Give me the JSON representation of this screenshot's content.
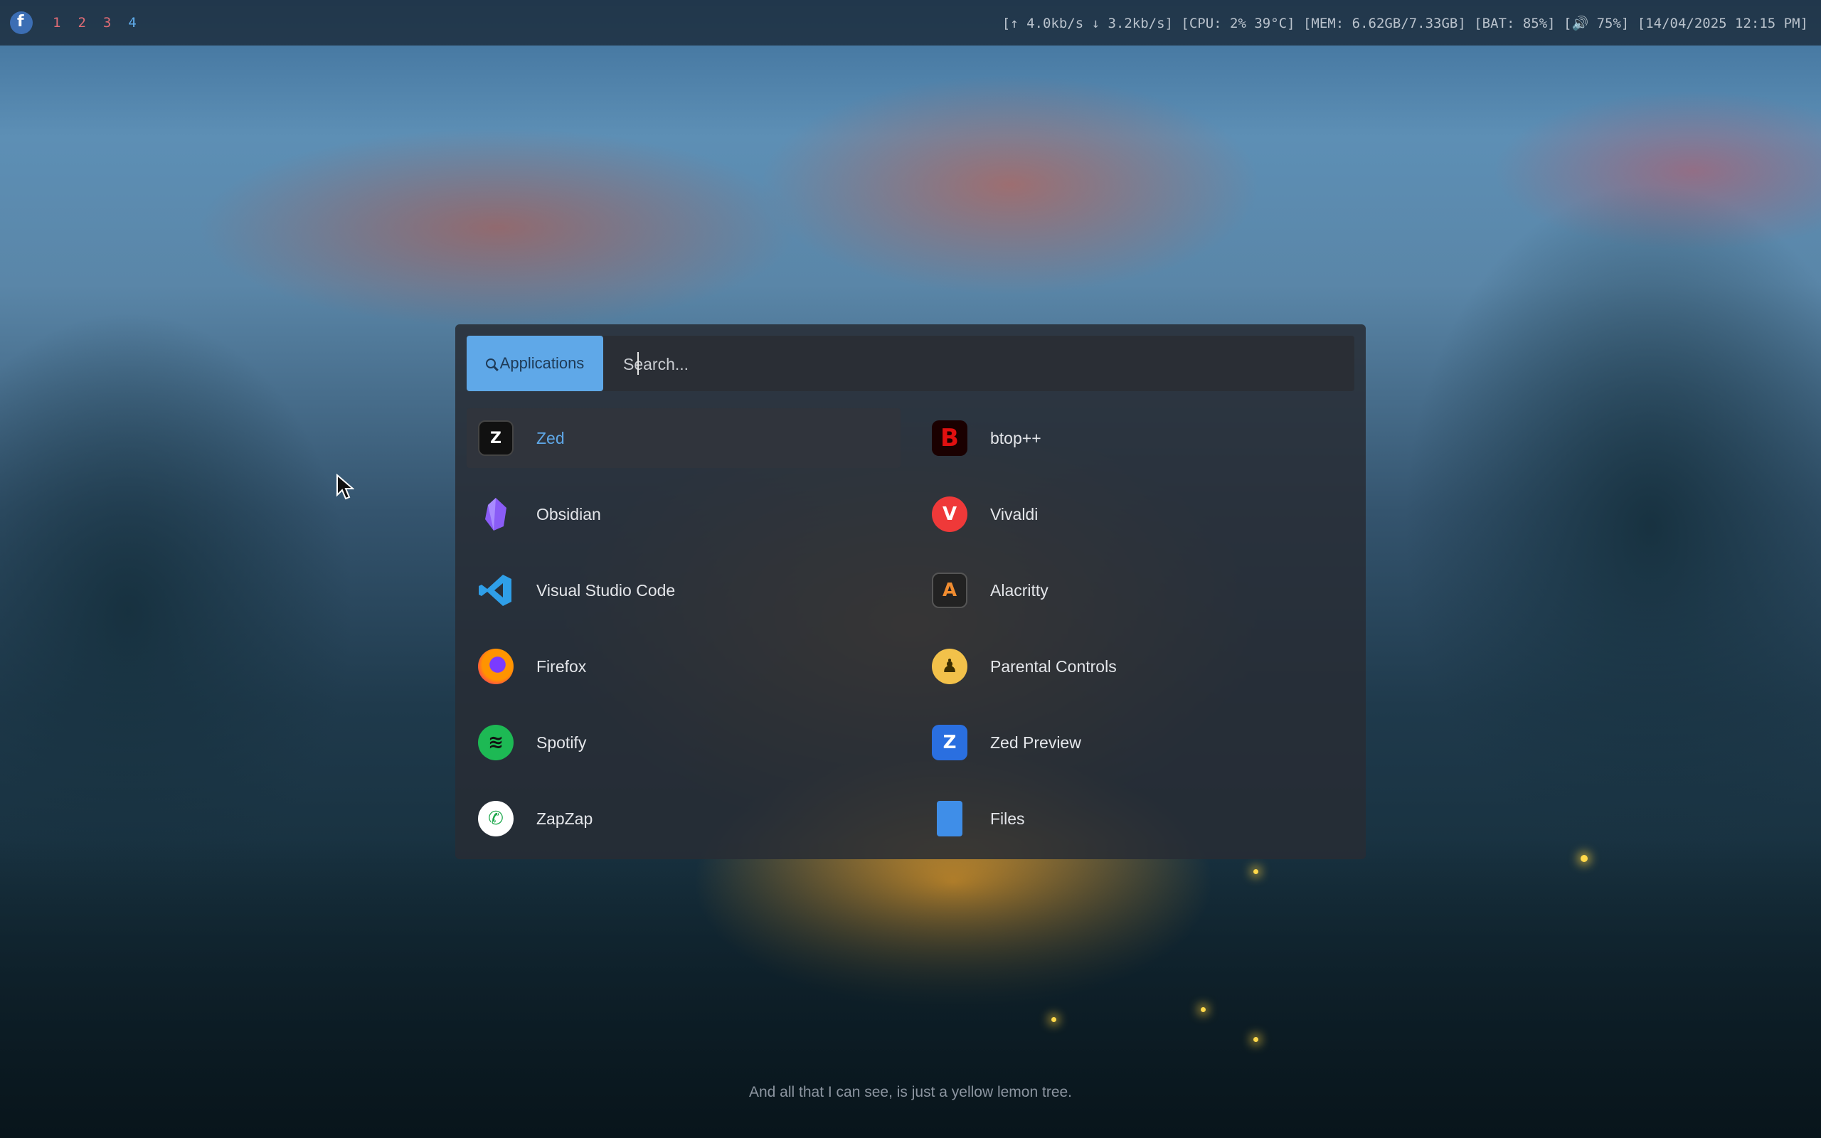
{
  "topbar": {
    "workspaces": [
      {
        "label": "1",
        "color": "#e06c75"
      },
      {
        "label": "2",
        "color": "#e06c75"
      },
      {
        "label": "3",
        "color": "#e06c75"
      },
      {
        "label": "4",
        "color": "#61afef"
      }
    ],
    "status": "[↑ 4.0kb/s ↓ 3.2kb/s] [CPU: 2% 39°C] [MEM: 6.62GB/7.33GB] [BAT: 85%] [🔊 75%] [14/04/2025 12:15 PM]"
  },
  "launcher": {
    "mode_label": "Applications",
    "search_placeholder": "Search...",
    "accent_color": "#5fa8e8",
    "apps": [
      {
        "label": "Zed",
        "icon": "zed-icon",
        "selected": true
      },
      {
        "label": "btop++",
        "icon": "btop-icon"
      },
      {
        "label": "Obsidian",
        "icon": "obsidian-icon"
      },
      {
        "label": "Vivaldi",
        "icon": "vivaldi-icon"
      },
      {
        "label": "Visual Studio Code",
        "icon": "vscode-icon"
      },
      {
        "label": "Alacritty",
        "icon": "alacritty-icon"
      },
      {
        "label": "Firefox",
        "icon": "firefox-icon"
      },
      {
        "label": "Parental Controls",
        "icon": "parental-controls-icon"
      },
      {
        "label": "Spotify",
        "icon": "spotify-icon"
      },
      {
        "label": "Zed Preview",
        "icon": "zed-preview-icon"
      },
      {
        "label": "ZapZap",
        "icon": "zapzap-icon"
      },
      {
        "label": "Files",
        "icon": "files-icon"
      }
    ]
  },
  "quote": "And all that I can see, is just a yellow lemon tree."
}
